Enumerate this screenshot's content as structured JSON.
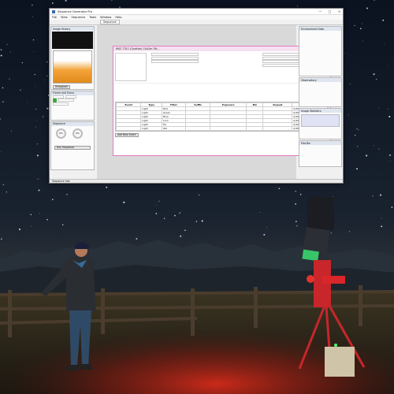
{
  "app": {
    "title": "Sequence Generator Pro",
    "menu": [
      "File",
      "View",
      "Sequence",
      "Tools",
      "Window",
      "Help"
    ],
    "doc_tab": "Sequence",
    "sequence_window_title": "M42 7311 (Quattro) 10x2m 3fr...",
    "left_panels": {
      "image_history": "Image History",
      "histogram": "Histogram",
      "focus": "Frame and Focus",
      "sequence": "Sequence"
    },
    "right_panels": {
      "environment": "Environment Data",
      "observatory": "Observatory",
      "image_statistics": "Image Statistics",
      "plate_solve": "Plot Bin"
    },
    "sequence_progress": [
      "0%",
      "0%"
    ],
    "events_header": [
      "Event",
      "Type",
      "Filter",
      "Suffix",
      "Exposure",
      "Bin",
      "Repeat",
      "Progress"
    ],
    "events": [
      {
        "type": "Light",
        "filter": "Red",
        "progress": "0/20"
      },
      {
        "type": "Light",
        "filter": "Green",
        "progress": "0/20"
      },
      {
        "type": "Light",
        "filter": "Blue",
        "progress": "0/20"
      },
      {
        "type": "Light",
        "filter": "Lum",
        "progress": "0/20"
      },
      {
        "type": "Light",
        "filter": "Ha",
        "progress": "0/20"
      },
      {
        "type": "Light",
        "filter": "OIII",
        "progress": "0/20"
      }
    ],
    "run_button": "Run Sequence",
    "add_event": "Add New Event",
    "status_text": "Sequence Idle"
  },
  "colors": {
    "sky_top": "#0c1320",
    "mountains": "#2b3340",
    "ground_red": "#b3281c",
    "telescope_red": "#d8262a",
    "scope_green": "#38c46a"
  }
}
